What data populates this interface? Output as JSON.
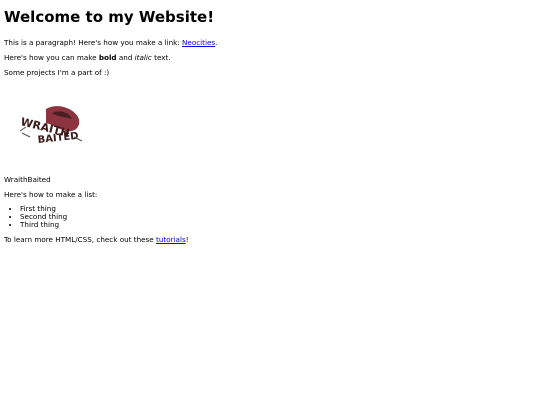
{
  "title": "Welcome to my Website!",
  "intro": {
    "text_before": "This is a paragraph! Here's how you make a link: ",
    "link_label": "Neocities",
    "text_after": "."
  },
  "formatting": {
    "text_before": "Here's how you can make ",
    "bold": "bold",
    "text_middle": " and ",
    "italic": "italic",
    "text_after": " text."
  },
  "projects": {
    "heading": "Some projects I'm a part of :)",
    "logo_text": "WRAITH BAITED",
    "caption": "WraithBaited"
  },
  "list_intro": "Here's how to make a list:",
  "list_items": [
    "First thing",
    "Second thing",
    "Third thing"
  ],
  "outro": {
    "text_before": "To learn more HTML/CSS, check out these ",
    "link_label": "tutorials",
    "text_after": "!"
  },
  "colors": {
    "link": "#0000ee",
    "logo_dark": "#3a1a1a",
    "logo_accent": "#7a1020"
  }
}
